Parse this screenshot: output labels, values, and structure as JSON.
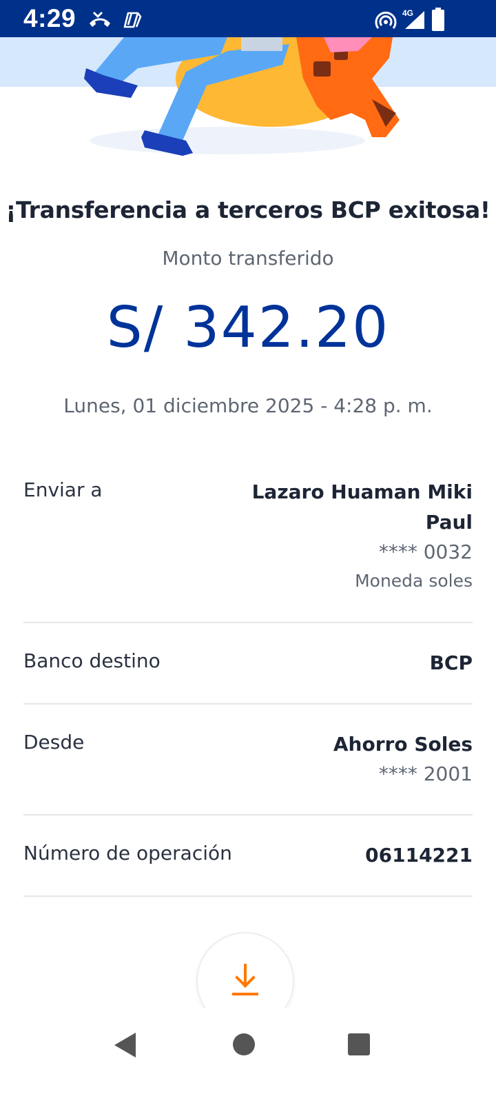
{
  "status_bar": {
    "time": "4:29",
    "network": "4G",
    "icons": [
      "missed-call-icon",
      "copilot-icon",
      "hotspot-icon",
      "signal-icon",
      "battery-icon"
    ]
  },
  "header": {
    "title": "¡Transferencia a terceros BCP exitosa!",
    "amount_label": "Monto transferido",
    "amount": "S/ 342.20",
    "datetime": "Lunes, 01 diciembre 2025 - 4:28 p. m."
  },
  "details": {
    "send_to": {
      "label": "Enviar a",
      "name_line1": "Lazaro Huaman Miki",
      "name_line2": "Paul",
      "account": "**** 0032",
      "currency": "Moneda soles"
    },
    "bank": {
      "label": "Banco destino",
      "value": "BCP"
    },
    "from": {
      "label": "Desde",
      "account_name": "Ahorro Soles",
      "account": "**** 2001"
    },
    "operation": {
      "label": "Número de operación",
      "value": "06114221"
    }
  },
  "actions": {
    "download_icon": "download-icon"
  },
  "nav": {
    "icons": [
      "back-icon",
      "home-icon",
      "recents-icon"
    ]
  },
  "colors": {
    "status_bar": "#00318a",
    "amount": "#003399",
    "accent": "#ff7800"
  }
}
